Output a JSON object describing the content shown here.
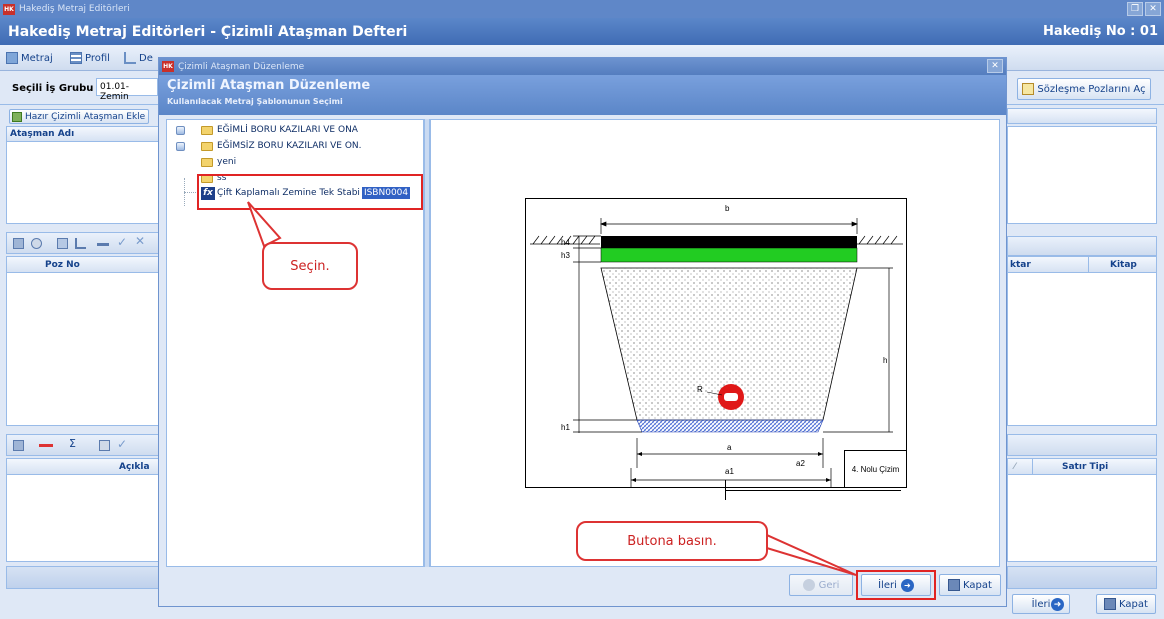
{
  "window": {
    "title": "Hakediş Metraj Editörleri",
    "heading": "Hakediş Metraj Editörleri - Çizimli Ataşman Defteri",
    "hakedis_no": "Hakediş No : 01",
    "app_icon": "HK"
  },
  "toolbar": {
    "metraj": "Metraj",
    "profil": "Profil",
    "det": "De"
  },
  "selection": {
    "label": "Seçili İş Grubu",
    "value": "01.01-Zemin",
    "open_contract_btn": "Sözleşme Pozlarını Aç"
  },
  "left_panel": {
    "add_ready_btn": "Hazır Çizimli Ataşman Ekle",
    "attachment_name_header": "Ataşman Adı",
    "poz_no_header": "Poz No",
    "aciklama_header": "Açıkla"
  },
  "right_panel": {
    "miktar_header": "ktar",
    "kitap_header": "Kitap",
    "satir_tipi_header": "Satır Tipi"
  },
  "footer": {
    "ileri": "İleri",
    "kapat": "Kapat"
  },
  "dialog": {
    "title": "Çizimli Ataşman Düzenleme",
    "heading": "Çizimli Ataşman Düzenleme",
    "subheading": "Kullanılacak Metraj Şablonunun Seçimi",
    "close": "x",
    "tree": [
      {
        "label": "EĞİMLİ BORU KAZILARI VE ONA",
        "type": "folder",
        "expandable": true
      },
      {
        "label": "EĞİMSİZ BORU KAZILARI VE ON.",
        "type": "folder",
        "expandable": true
      },
      {
        "label": "yeni",
        "type": "folder",
        "expandable": false
      },
      {
        "label": "ss",
        "type": "folder",
        "expandable": false
      },
      {
        "label": "Çift Kaplamalı Zemine Tek Stabi",
        "code": "ISBN0004",
        "type": "template",
        "selected": true
      }
    ],
    "buttons": {
      "geri": "Geri",
      "ileri": "İleri",
      "kapat": "Kapat"
    },
    "drawing": {
      "b": "b",
      "h4": "h4",
      "h3": "h3",
      "h": "h",
      "r": "R",
      "h1": "h1",
      "a": "a",
      "a1": "a1",
      "a2": "a2",
      "caption": "4. Nolu Çizim"
    }
  },
  "annotations": {
    "select_hint": "Seçin.",
    "press_button_hint": "Butona basın."
  },
  "colors": {
    "header_blue": "#3f6cb4",
    "panel_border": "#99bbe8",
    "highlight_red": "#e02424",
    "green_layer": "#22cc22"
  }
}
